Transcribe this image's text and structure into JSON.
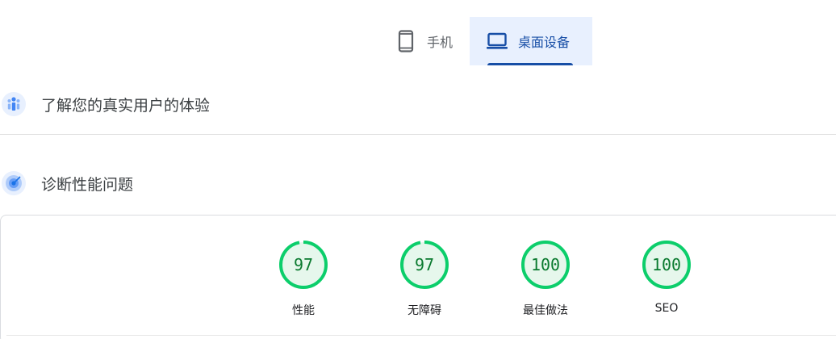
{
  "tabs": {
    "mobile": {
      "label": "手机",
      "icon": "smartphone-icon"
    },
    "desktop": {
      "label": "桌面设备",
      "icon": "laptop-icon",
      "selected": true
    }
  },
  "sections": [
    {
      "title": "了解您的真实用户的体验",
      "icon": "user-experience-icon"
    },
    {
      "title": "诊断性能问题",
      "icon": "diagnose-icon"
    }
  ],
  "scores": [
    {
      "value": "97",
      "label": "性能",
      "fraction": 0.97
    },
    {
      "value": "97",
      "label": "无障碍",
      "fraction": 0.97
    },
    {
      "value": "100",
      "label": "最佳做法",
      "fraction": 1.0
    },
    {
      "value": "100",
      "label": "SEO",
      "fraction": 1.0
    }
  ],
  "colors": {
    "accent": "#174ea6",
    "tab_selected_bg": "#e8f0fe",
    "score_good": "#0cce6b",
    "score_good_fill": "#e6f7ec",
    "score_text": "#0a7a2f"
  }
}
